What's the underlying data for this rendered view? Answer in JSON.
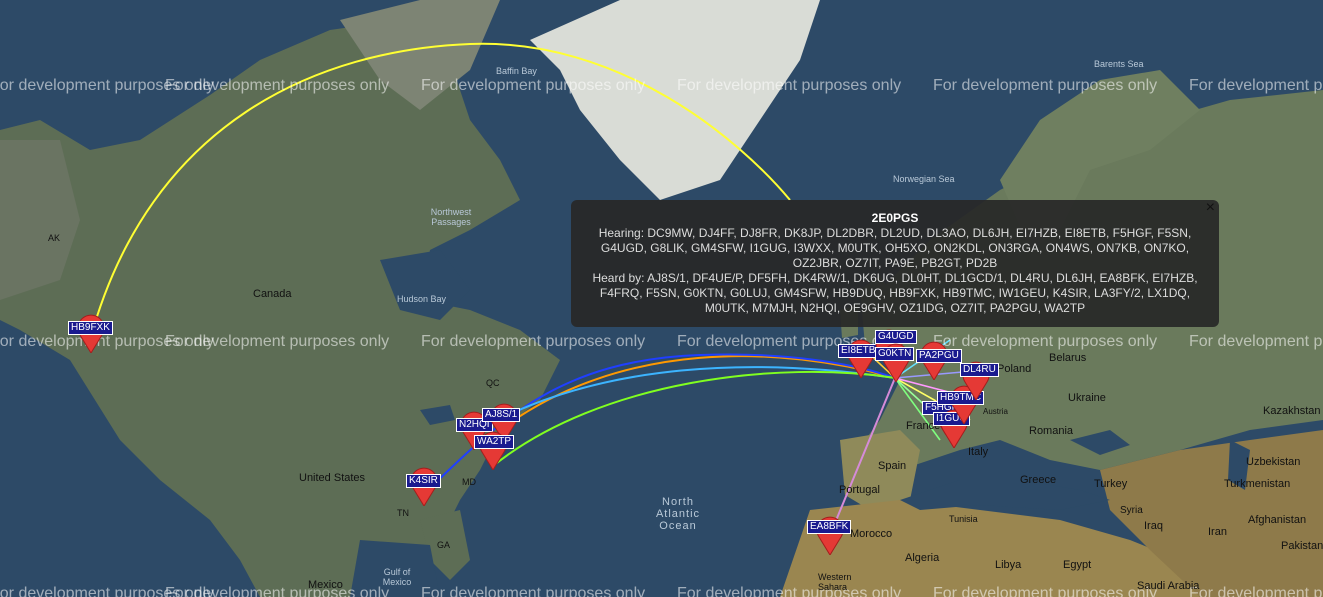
{
  "watermark": "For development purposes only",
  "places": {
    "canada": "Canada",
    "united_states": "United States",
    "mexico": "Mexico",
    "spain": "Spain",
    "portugal": "Portugal",
    "france": "France",
    "italy": "Italy",
    "poland": "Poland",
    "belarus": "Belarus",
    "ukraine": "Ukraine",
    "romania": "Romania",
    "greece": "Greece",
    "turkey": "Turkey",
    "syria": "Syria",
    "iraq": "Iraq",
    "iran": "Iran",
    "afghanistan": "Afghanistan",
    "pakistan": "Pakistan",
    "uzbekistan": "Uzbekistan",
    "turkmenistan": "Turkmenistan",
    "kazakhstan": "Kazakhstan",
    "morocco": "Morocco",
    "algeria": "Algeria",
    "libya": "Libya",
    "egypt": "Egypt",
    "saudi_arabia": "Saudi Arabia",
    "tunisia": "Tunisia",
    "western_sahara": "Western Sahara",
    "ak": "AK",
    "qc": "QC",
    "tn": "TN",
    "md": "MD",
    "ga": "GA",
    "austria": "Austria"
  },
  "seas": {
    "baffin_bay": "Baffin Bay",
    "barents_sea": "Barents Sea",
    "norwegian_sea": "Norwegian Sea",
    "northwest_passages": "Northwest Passages",
    "hudson_bay": "Hudson Bay",
    "gulf_of_mexico": "Gulf of Mexico",
    "north_atlantic_ocean": "North Atlantic Ocean"
  },
  "markers": [
    {
      "call": "HB9FXK"
    },
    {
      "call": "K4SIR"
    },
    {
      "call": "N2HQI"
    },
    {
      "call": "AJ8S/1"
    },
    {
      "call": "WA2TP"
    },
    {
      "call": "EA8BFK"
    },
    {
      "call": "EI8ETB"
    },
    {
      "call": "G4UGD"
    },
    {
      "call": "G0KTN"
    },
    {
      "call": "PA2PGU"
    },
    {
      "call": "F5HGF"
    },
    {
      "call": "I1GUG"
    },
    {
      "call": "HB9TMC"
    },
    {
      "call": "DL4RU"
    }
  ],
  "popup": {
    "title": "2E0PGS",
    "hearing": "Hearing: DC9MW, DJ4FF, DJ8FR, DK8JP, DL2DBR, DL2UD, DL3AO, DL6JH, EI7HZB, EI8ETB, F5HGF, F5SN, G4UGD, G8LIK, GM4SFW, I1GUG, I3WXX, M0UTK, OH5XO, ON2KDL, ON3RGA, ON4WS, ON7KB, ON7KO, OZ2JBR, OZ7IT, PA9E, PB2GT, PD2B",
    "heard_by": "Heard by: AJ8S/1, DF4UE/P, DF5FH, DK4RW/1, DK6UG, DL0HT, DL1GCD/1, DL4RU, DL6JH, EA8BFK, EI7HZB, F4FRQ, F5SN, G0KTN, G0LUJ, GM4SFW, HB9DUQ, HB9FXK, HB9TMC, IW1GEU, K4SIR, LA3FY/2, LX1DQ, M0UTK, M7MJH, N2HQI, OE9GHV, OZ1IDG, OZ7IT, PA2PGU, WA2TP",
    "close": "×"
  },
  "colors": {
    "ocean": "#2d4a67",
    "land": "#5a6b4e",
    "desert": "#8e7a4a",
    "marker": "#e53935",
    "label_bg": "#1a1a8f",
    "path_yellow": "#ffff33",
    "path_orange": "#ff9900",
    "path_blue": "#1f3fff",
    "path_green": "#80ff20",
    "path_violet": "#d58bd8"
  }
}
